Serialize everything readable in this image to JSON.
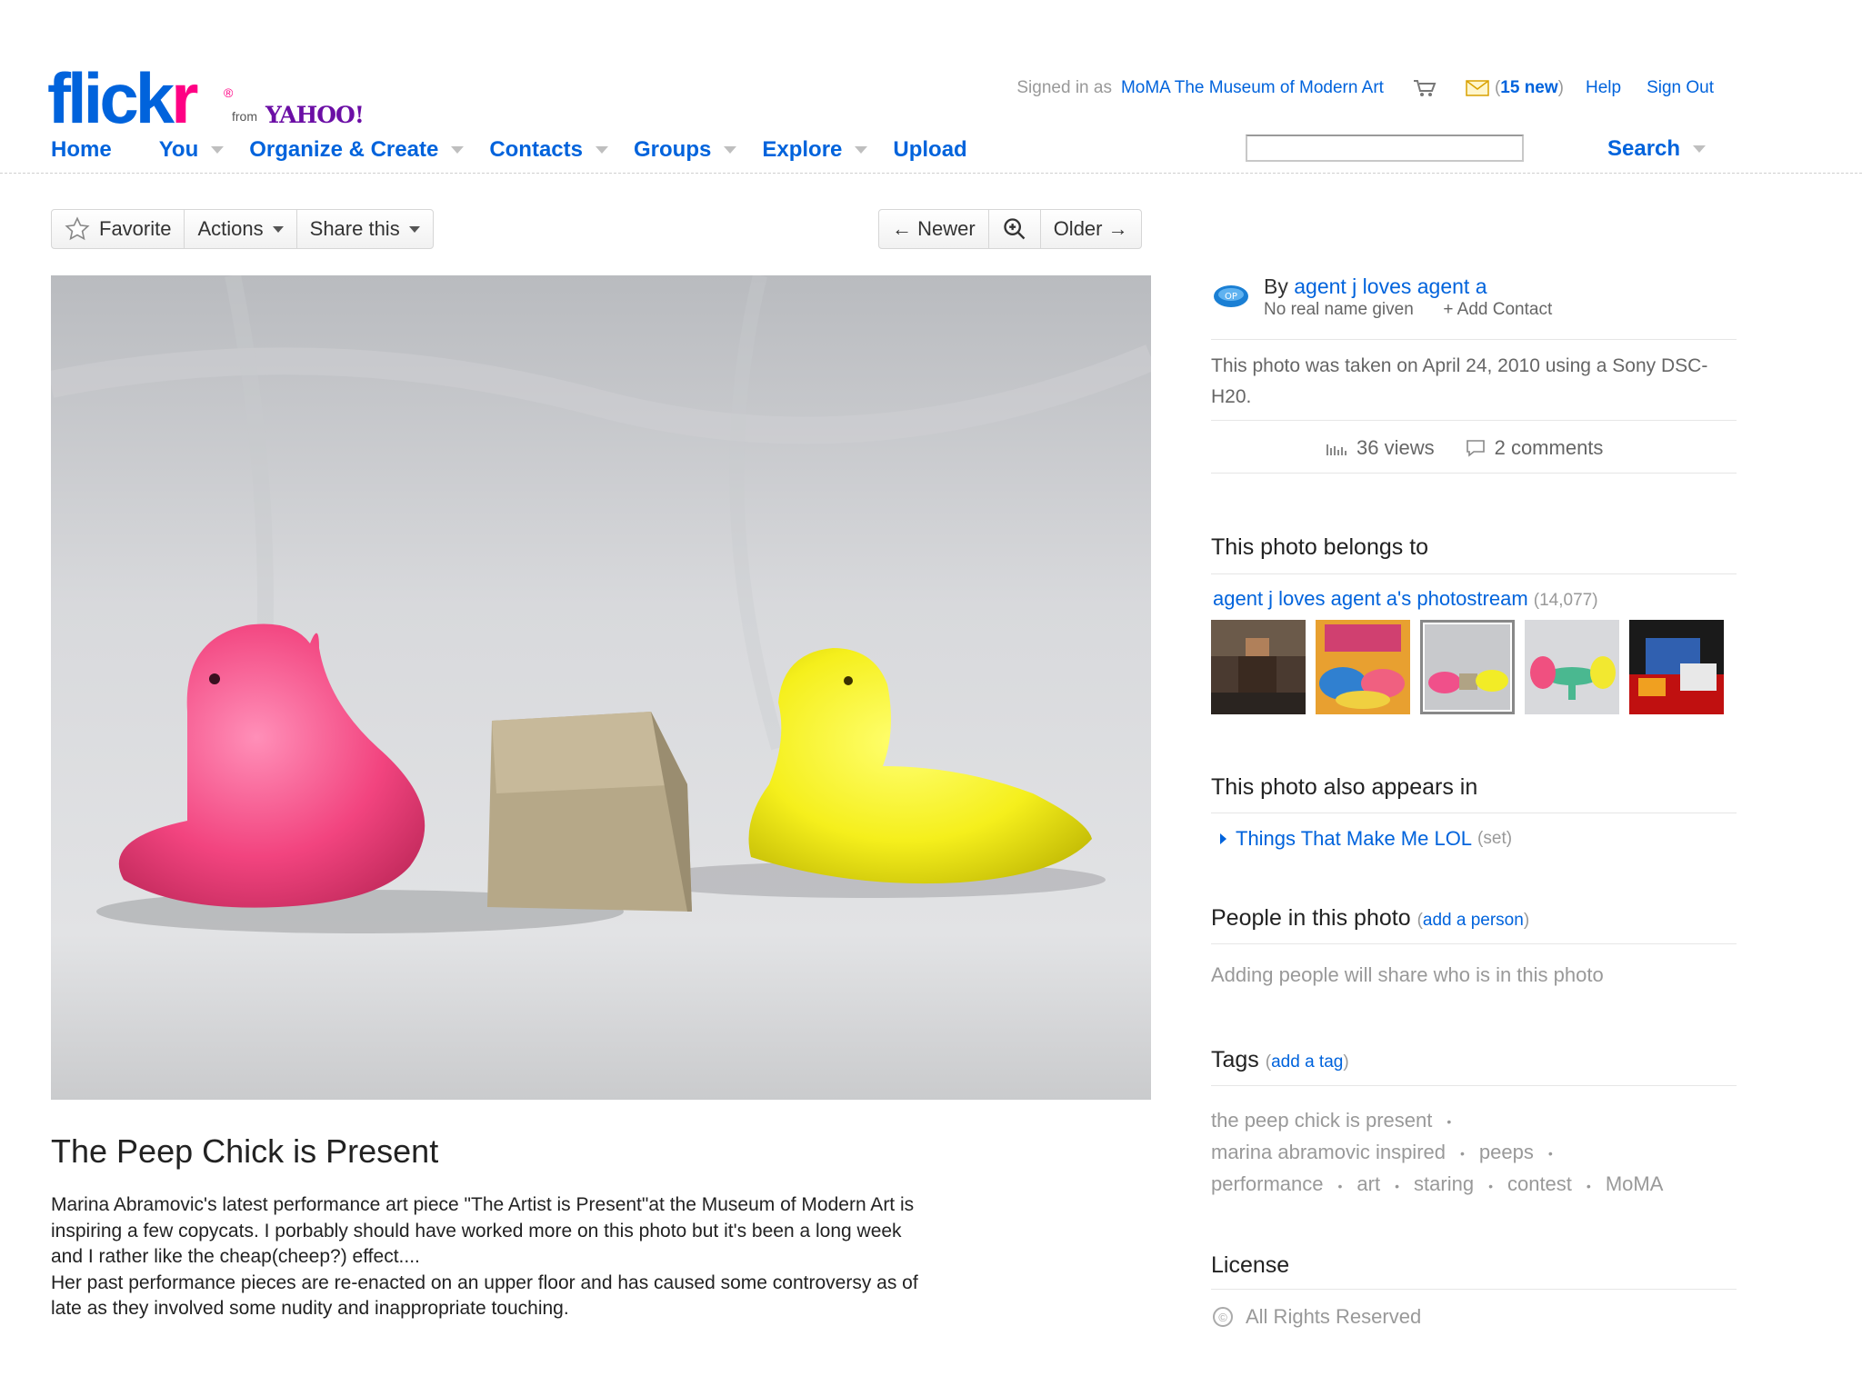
{
  "logo": {
    "part1": "flick",
    "part2": "r",
    "reg": "®",
    "from": "from",
    "yahoo": "YAHOO!"
  },
  "userbar": {
    "signed_in_as": "Signed in as",
    "user": "MoMA The Museum of Modern Art",
    "mail_count": "15 new",
    "help": "Help",
    "sign_out": "Sign Out"
  },
  "nav": [
    {
      "label": "Home"
    },
    {
      "label": "You"
    },
    {
      "label": "Organize & Create"
    },
    {
      "label": "Contacts"
    },
    {
      "label": "Groups"
    },
    {
      "label": "Explore"
    },
    {
      "label": "Upload"
    }
  ],
  "search": {
    "value": "",
    "button": "Search"
  },
  "toolbar": {
    "favorite": "Favorite",
    "actions": "Actions",
    "share": "Share this",
    "newer": "← Newer",
    "older": "Older →"
  },
  "photo": {
    "title": "The Peep Chick is Present",
    "description": [
      "Marina Abramovic's latest performance art piece \"The Artist is Present\"at the Museum of Modern Art is",
      "inspiring a few copycats. I porbably should have worked more on this photo but it's been a long week",
      "and I rather like the cheap(cheep?) effect....",
      "Her past performance pieces are re-enacted on an upper floor and has caused some controversy as of",
      "late as they involved some nudity and inappropriate touching."
    ]
  },
  "owner": {
    "by": "By",
    "name": "agent j loves agent a",
    "real_name": "No real name given",
    "add_contact": "+ Add Contact"
  },
  "taken": "This photo was taken on April 24, 2010 using a Sony DSC-H20.",
  "stats": {
    "views": "36 views",
    "comments": "2 comments"
  },
  "belongs": {
    "heading": "This photo belongs to",
    "photostream": "agent j loves agent a's photostream",
    "count": "(14,077)"
  },
  "appears": {
    "heading": "This photo also appears in",
    "set_name": "Things That Make Me LOL",
    "set_type": "(set)"
  },
  "people": {
    "heading": "People in this photo",
    "add_open": "(",
    "add": "add a person",
    "add_close": ")",
    "note": "Adding people will share who is in this photo"
  },
  "tags": {
    "heading": "Tags",
    "add_open": "(",
    "add": "add a tag",
    "add_close": ")",
    "items": [
      "the peep chick is present",
      "marina abramovic inspired",
      "peeps",
      "performance",
      "art",
      "staring",
      "contest",
      "MoMA"
    ]
  },
  "license": {
    "heading": "License",
    "text": "All Rights Reserved",
    "symbol": "©"
  },
  "colors": {
    "link": "#0063dc",
    "flickr_pink": "#ff0084",
    "yahoo_purple": "#6b0ea5"
  }
}
